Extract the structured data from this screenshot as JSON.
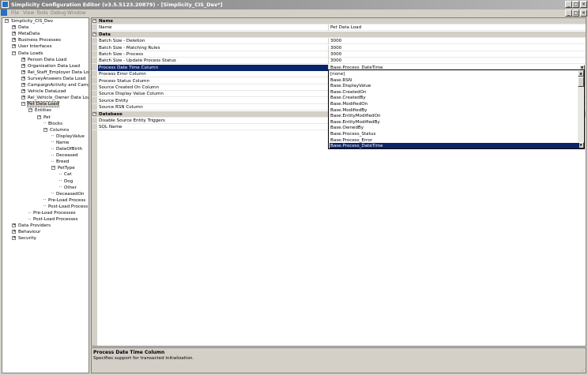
{
  "window": {
    "title": "Simplicity Configuration Editor (v3.5.5123.20879) - [Simplicity_CIS_Dev*]",
    "controls": [
      "_",
      "□",
      "×"
    ],
    "mdi_controls": [
      "_",
      "□",
      "×"
    ]
  },
  "menu": {
    "items": [
      "File",
      "View",
      "Tools",
      "Debug",
      "Window"
    ]
  },
  "tree": {
    "nodes": [
      {
        "label": "Simplicity_CIS_Dev",
        "level": 0,
        "expander": "−"
      },
      {
        "label": "Data",
        "level": 1,
        "expander": "+"
      },
      {
        "label": "MetaData",
        "level": 1,
        "expander": "+"
      },
      {
        "label": "Business Processes",
        "level": 1,
        "expander": "+"
      },
      {
        "label": "User Interfaces",
        "level": 1,
        "expander": "+"
      },
      {
        "label": "Data Loads",
        "level": 1,
        "expander": "−"
      },
      {
        "label": "Person Data Load",
        "level": 2,
        "expander": "+"
      },
      {
        "label": "Organisation Data Load",
        "level": 2,
        "expander": "+"
      },
      {
        "label": "Rel_Staff_Employer Data Load",
        "level": 2,
        "expander": "+"
      },
      {
        "label": "SurveyAnswers Data Load",
        "level": 2,
        "expander": "+"
      },
      {
        "label": "CampaignActivity and Campaign",
        "level": 2,
        "expander": "+"
      },
      {
        "label": "Vehicle DataLoad",
        "level": 2,
        "expander": "+"
      },
      {
        "label": "Rel_Vehicle_Owner Data Load",
        "level": 2,
        "expander": "+"
      },
      {
        "label": "Pet Data Load",
        "level": 2,
        "expander": "−",
        "selected": true
      },
      {
        "label": "Entities",
        "level": 3,
        "expander": "−"
      },
      {
        "label": "Pet",
        "level": 4,
        "expander": "−"
      },
      {
        "label": "Blocks",
        "level": 5,
        "expander": ""
      },
      {
        "label": "Columns",
        "level": 5,
        "expander": "−"
      },
      {
        "label": "DisplayValue",
        "level": 6,
        "expander": ""
      },
      {
        "label": "Name",
        "level": 6,
        "expander": ""
      },
      {
        "label": "DateOfBirth",
        "level": 6,
        "expander": ""
      },
      {
        "label": "Deceased",
        "level": 6,
        "expander": ""
      },
      {
        "label": "Breed",
        "level": 6,
        "expander": ""
      },
      {
        "label": "PetType",
        "level": 6,
        "expander": "−"
      },
      {
        "label": "Cat",
        "level": 7,
        "expander": ""
      },
      {
        "label": "Dog",
        "level": 7,
        "expander": ""
      },
      {
        "label": "Other",
        "level": 7,
        "expander": ""
      },
      {
        "label": "DeceasedOn",
        "level": 6,
        "expander": ""
      },
      {
        "label": "Pre-Load Process",
        "level": 5,
        "expander": ""
      },
      {
        "label": "Post-Load Process",
        "level": 5,
        "expander": ""
      },
      {
        "label": "Pre-Load Processes",
        "level": 3,
        "expander": ""
      },
      {
        "label": "Post-Load Processes",
        "level": 3,
        "expander": ""
      },
      {
        "label": "Data Providers",
        "level": 1,
        "expander": "+"
      },
      {
        "label": "Behaviour",
        "level": 1,
        "expander": "+"
      },
      {
        "label": "Security",
        "level": 1,
        "expander": "+"
      }
    ]
  },
  "grid": {
    "rows": [
      {
        "type": "cat",
        "name": "Name"
      },
      {
        "type": "prop",
        "name": "Name",
        "value": "Pet Data Load"
      },
      {
        "type": "cat",
        "name": "Data"
      },
      {
        "type": "prop",
        "name": "Batch Size - Deletion",
        "value": "3000"
      },
      {
        "type": "prop",
        "name": "Batch Size - Matching Rules",
        "value": "3000"
      },
      {
        "type": "prop",
        "name": "Batch Size - Process",
        "value": "3000"
      },
      {
        "type": "prop",
        "name": "Batch Size - Update Process Status",
        "value": "3000"
      },
      {
        "type": "prop",
        "name": "Process Date Time Column",
        "value": "Base.Process_DateTime",
        "selected": true,
        "dropdown": true
      },
      {
        "type": "prop",
        "name": "Process Error Column",
        "value": ""
      },
      {
        "type": "prop",
        "name": "Process Status Column",
        "value": ""
      },
      {
        "type": "prop",
        "name": "Source Created On Column",
        "value": ""
      },
      {
        "type": "prop",
        "name": "Source Display Value Column",
        "value": ""
      },
      {
        "type": "prop",
        "name": "Source Entity",
        "value": ""
      },
      {
        "type": "prop",
        "name": "Source RSN Column",
        "value": ""
      },
      {
        "type": "cat",
        "name": "Database"
      },
      {
        "type": "prop",
        "name": "Disable Source Entity Triggers",
        "value": ""
      },
      {
        "type": "prop",
        "name": "SQL Name",
        "value": ""
      }
    ]
  },
  "dropdown": {
    "items": [
      "[none]",
      "Base.RSN",
      "Base.DisplayValue",
      "Base.CreatedOn",
      "Base.CreatedBy",
      "Base.ModifiedOn",
      "Base.ModifiedBy",
      "Base.EntityModifiedOn",
      "Base.EntityModifiedBy",
      "Base.OwnedBy",
      "Base.Process_Status",
      "Base.Process_Error",
      "Base.Process_DateTime"
    ],
    "selected_index": 12
  },
  "help": {
    "title": "Process Date Time Column",
    "description": "Specifies support for transacted initialization."
  }
}
